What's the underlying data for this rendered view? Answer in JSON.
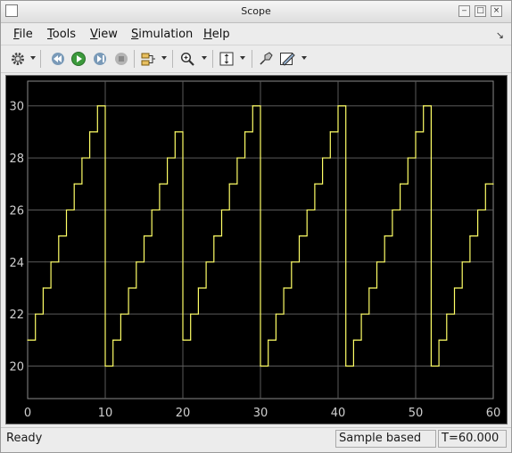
{
  "window": {
    "title": "Scope"
  },
  "menu": [
    "File",
    "Tools",
    "View",
    "Simulation",
    "Help"
  ],
  "menu_mnemonics": [
    "F",
    "T",
    "V",
    "S",
    "H"
  ],
  "toolbar": {
    "icons": [
      "gear-icon",
      "rewind-icon",
      "run-icon",
      "step-forward-icon",
      "stop-icon",
      "signal-select-icon",
      "zoom-icon",
      "scale-axes-icon",
      "highlight-icon",
      "edit-icon"
    ]
  },
  "plot": {
    "background": "#000000",
    "grid_color": "#5a5a5a",
    "line_color": "#ffff66",
    "tick_color": "#cfcfcf"
  },
  "chart_data": {
    "type": "line",
    "style": "stairs",
    "xlim": [
      0,
      60
    ],
    "ylim": [
      18.75,
      30.95
    ],
    "xticks": [
      0,
      10,
      20,
      30,
      40,
      50,
      60
    ],
    "yticks": [
      20,
      22,
      24,
      26,
      28,
      30
    ],
    "grid": true,
    "title": "",
    "xlabel": "",
    "ylabel": "",
    "series": [
      {
        "x": [
          0,
          1,
          2,
          3,
          4,
          5,
          6,
          7,
          8,
          9,
          10,
          11,
          12,
          13,
          14,
          15,
          16,
          17,
          18,
          19,
          20,
          21,
          22,
          23,
          24,
          25,
          26,
          27,
          28,
          29,
          30,
          31,
          32,
          33,
          34,
          35,
          36,
          37,
          38,
          39,
          40,
          41,
          42,
          43,
          44,
          45,
          46,
          47,
          48,
          49,
          50,
          51,
          52,
          53,
          54,
          55,
          56,
          57,
          58,
          59,
          60
        ],
        "y": [
          21,
          22,
          23,
          24,
          25,
          26,
          27,
          28,
          29,
          30,
          20,
          21,
          22,
          23,
          24,
          25,
          26,
          27,
          28,
          29,
          21,
          22,
          23,
          24,
          25,
          26,
          27,
          28,
          29,
          30,
          20,
          21,
          22,
          23,
          24,
          25,
          26,
          27,
          28,
          29,
          30,
          20,
          21,
          22,
          23,
          24,
          25,
          26,
          27,
          28,
          29,
          30,
          20,
          21,
          22,
          23,
          24,
          25,
          26,
          27,
          27
        ]
      }
    ]
  },
  "status": {
    "ready": "Ready",
    "mode": "Sample based",
    "time": "T=60.000"
  }
}
